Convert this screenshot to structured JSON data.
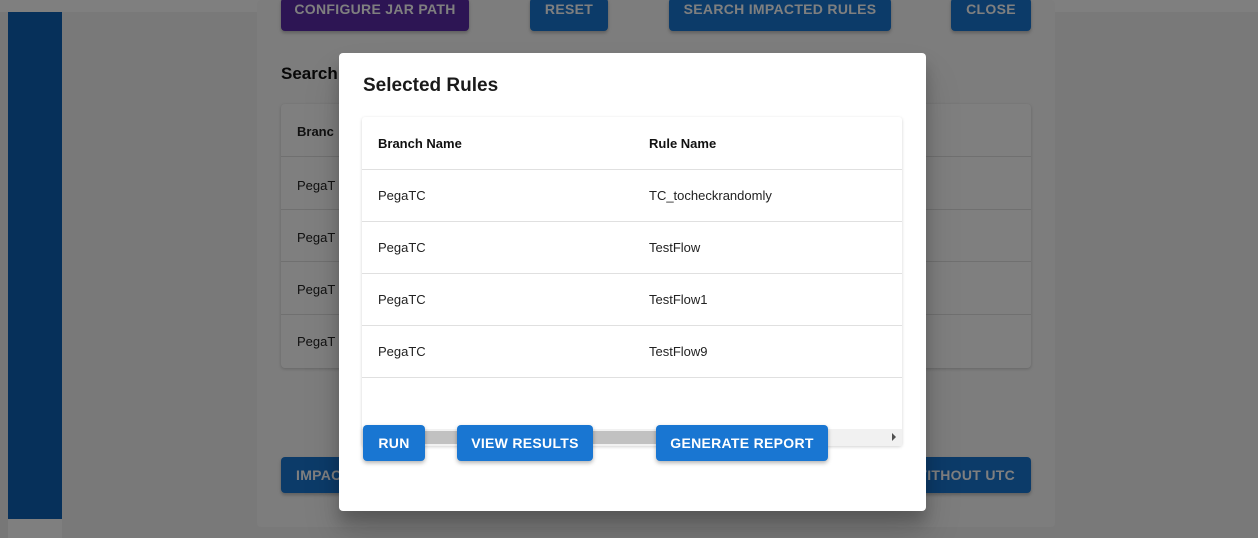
{
  "background": {
    "top_buttons": [
      "Configure Jar Path",
      "Reset",
      "Search Impacted Rules",
      "Close"
    ],
    "search_heading": "Search",
    "table": {
      "header_fragment": "Branc",
      "row_fragments": [
        "PegaT",
        "PegaT",
        "PegaT",
        "PegaT"
      ]
    },
    "bottom_buttons": {
      "left_fragment": "IMPAC",
      "right_fragment": "VITHOUT UTC"
    },
    "colors": {
      "sidebar": "#0d60b5",
      "primary": "#1976d2",
      "purple": "#5a2aa8"
    }
  },
  "dialog": {
    "title": "Selected Rules",
    "columns": [
      "Branch Name",
      "Rule Name"
    ],
    "rows": [
      {
        "branch": "PegaTC",
        "rule": "TC_tocheckrandomly"
      },
      {
        "branch": "PegaTC",
        "rule": "TestFlow"
      },
      {
        "branch": "PegaTC",
        "rule": "TestFlow1"
      },
      {
        "branch": "PegaTC",
        "rule": "TestFlow9"
      }
    ],
    "buttons": {
      "run": "Run",
      "view_results": "View Results",
      "generate_report": "Generate Report"
    }
  }
}
